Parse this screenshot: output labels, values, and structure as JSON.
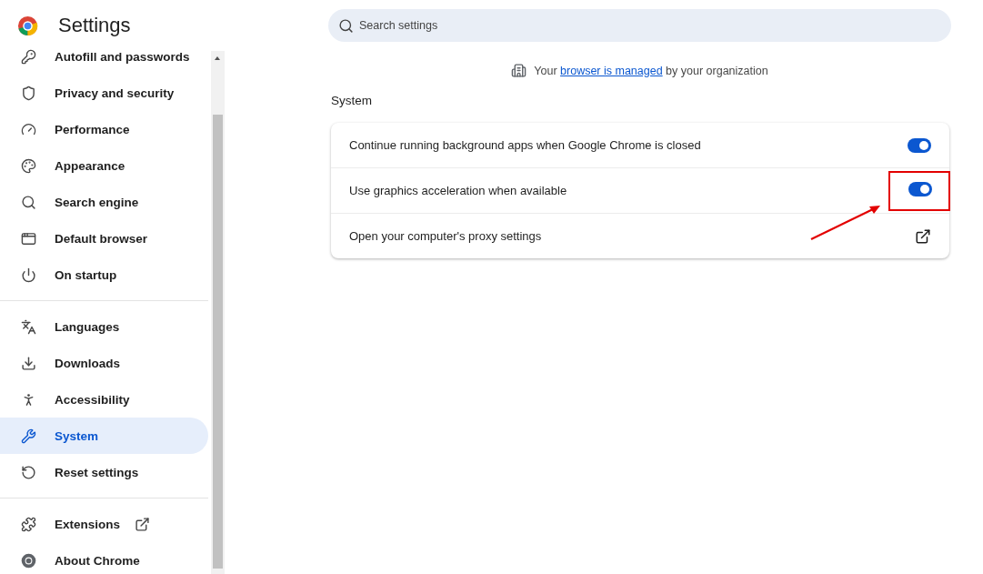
{
  "header": {
    "title": "Settings"
  },
  "sidebar": {
    "groups": [
      {
        "items": [
          {
            "label": "Autofill and passwords",
            "selected": false
          },
          {
            "label": "Privacy and security",
            "selected": false
          },
          {
            "label": "Performance",
            "selected": false
          },
          {
            "label": "Appearance",
            "selected": false
          },
          {
            "label": "Search engine",
            "selected": false
          },
          {
            "label": "Default browser",
            "selected": false
          },
          {
            "label": "On startup",
            "selected": false
          }
        ]
      },
      {
        "items": [
          {
            "label": "Languages",
            "selected": false
          },
          {
            "label": "Downloads",
            "selected": false
          },
          {
            "label": "Accessibility",
            "selected": false
          },
          {
            "label": "System",
            "selected": true
          },
          {
            "label": "Reset settings",
            "selected": false
          }
        ]
      },
      {
        "items": [
          {
            "label": "Extensions",
            "selected": false,
            "external": true
          },
          {
            "label": "About Chrome",
            "selected": false
          }
        ]
      }
    ]
  },
  "search": {
    "placeholder": "Search settings"
  },
  "managed_notice": {
    "before": "Your",
    "link": "browser is managed",
    "after": "by your organization"
  },
  "section": {
    "title": "System",
    "rows": [
      {
        "kind": "toggle",
        "label": "Continue running background apps when Google Chrome is closed",
        "on": true,
        "highlighted": false
      },
      {
        "kind": "toggle",
        "label": "Use graphics acceleration when available",
        "on": true,
        "highlighted": true
      },
      {
        "kind": "link",
        "label": "Open your computer's proxy settings",
        "highlighted": false
      }
    ]
  }
}
